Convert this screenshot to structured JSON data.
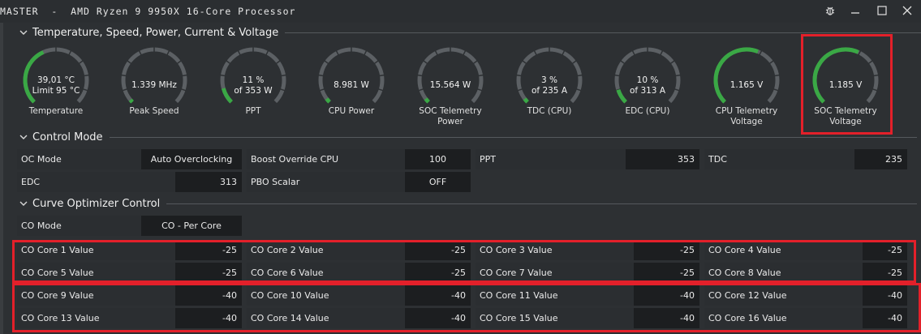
{
  "window": {
    "title": "MASTER  -  AMD Ryzen 9 9950X 16-Core Processor",
    "bug_icon": "bug-icon",
    "minimize_icon": "minimize-icon",
    "maximize_icon": "maximize-icon",
    "close_icon": "close-icon"
  },
  "sections": {
    "sensors": "Temperature, Speed, Power, Current & Voltage",
    "control": "Control Mode",
    "curve": "Curve Optimizer Control"
  },
  "gauges": [
    {
      "line1": "39,01 °C",
      "line2": "Limit 95 °C",
      "label1": "Temperature",
      "label2": "",
      "level": 0.41,
      "color": "#3aa845"
    },
    {
      "line1": "1.339  MHz",
      "line2": "",
      "label1": "Peak Speed",
      "label2": "",
      "level": 0.02,
      "color": "#3aa845"
    },
    {
      "line1": "11 %",
      "line2": "of 353 W",
      "label1": "PPT",
      "label2": "",
      "level": 0.11,
      "color": "#3aa845"
    },
    {
      "line1": "8.981 W",
      "line2": "",
      "label1": "CPU Power",
      "label2": "",
      "level": 0.03,
      "color": "#3aa845"
    },
    {
      "line1": "15.564 W",
      "line2": "",
      "label1": "SOC Telemetry",
      "label2": "Power",
      "level": 0.03,
      "color": "#3aa845"
    },
    {
      "line1": "3 %",
      "line2": "of 235 A",
      "label1": "TDC (CPU)",
      "label2": "",
      "level": 0.03,
      "color": "#3aa845"
    },
    {
      "line1": "10 %",
      "line2": "of 313 A",
      "label1": "EDC (CPU)",
      "label2": "",
      "level": 0.1,
      "color": "#3aa845"
    },
    {
      "line1": "1.165 V",
      "line2": "",
      "label1": "CPU Telemetry",
      "label2": "Voltage",
      "level": 0.58,
      "color": "#3aa845"
    },
    {
      "line1": "1.185 V",
      "line2": "",
      "label1": "SOC Telemetry",
      "label2": "Voltage",
      "level": 0.59,
      "color": "#3aa845"
    }
  ],
  "control": [
    {
      "label": "OC Mode",
      "value": "Auto Overclocking"
    },
    {
      "label": "Boost Override CPU",
      "value": "100"
    },
    {
      "label": "PPT",
      "value": "353"
    },
    {
      "label": "TDC",
      "value": "235"
    },
    {
      "label": "EDC",
      "value": "313"
    },
    {
      "label": "PBO Scalar",
      "value": "OFF"
    }
  ],
  "co_mode": {
    "label": "CO Mode",
    "value": "CO - Per Core"
  },
  "cores": [
    {
      "label": "CO Core 1 Value",
      "value": "-25"
    },
    {
      "label": "CO Core 2 Value",
      "value": "-25"
    },
    {
      "label": "CO Core 3 Value",
      "value": "-25"
    },
    {
      "label": "CO Core 4 Value",
      "value": "-25"
    },
    {
      "label": "CO Core 5 Value",
      "value": "-25"
    },
    {
      "label": "CO Core 6 Value",
      "value": "-25"
    },
    {
      "label": "CO Core 7 Value",
      "value": "-25"
    },
    {
      "label": "CO Core 8 Value",
      "value": "-25"
    },
    {
      "label": "CO Core 9 Value",
      "value": "-40"
    },
    {
      "label": "CO Core 10 Value",
      "value": "-40"
    },
    {
      "label": "CO Core 11 Value",
      "value": "-40"
    },
    {
      "label": "CO Core 12 Value",
      "value": "-40"
    },
    {
      "label": "CO Core 13 Value",
      "value": "-40"
    },
    {
      "label": "CO Core 14 Value",
      "value": "-40"
    },
    {
      "label": "CO Core 15 Value",
      "value": "-40"
    },
    {
      "label": "CO Core 16 Value",
      "value": "-40"
    }
  ],
  "colors": {
    "accent": "#3aa845",
    "highlight": "#e3202a",
    "track": "#5c6064"
  }
}
